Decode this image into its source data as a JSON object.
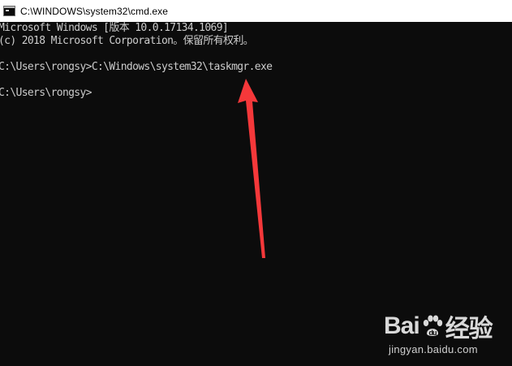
{
  "window": {
    "title": "C:\\WINDOWS\\system32\\cmd.exe",
    "icon": "cmd-console-icon"
  },
  "console": {
    "lines": [
      "Microsoft Windows [版本 10.0.17134.1069]",
      "(c) 2018 Microsoft Corporation。保留所有权利。",
      "",
      "C:\\Users\\rongsy>C:\\Windows\\system32\\taskmgr.exe",
      "",
      "C:\\Users\\rongsy>"
    ]
  },
  "annotation": {
    "icon": "red-arrow-icon",
    "color": "#f5383a"
  },
  "watermark": {
    "logo_left": "Bai",
    "logo_right": "经验",
    "logo_icon": "paw-icon",
    "url": "jingyan.baidu.com"
  },
  "colors": {
    "console_bg": "#0c0c0c",
    "console_text": "#cccccc",
    "titlebar_bg": "#ffffff"
  }
}
